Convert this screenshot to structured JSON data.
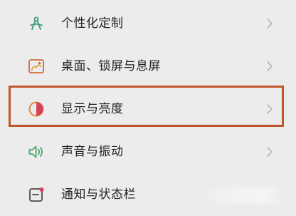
{
  "settings": {
    "items": [
      {
        "label": "个性化定制",
        "icon": "personalize-icon"
      },
      {
        "label": "桌面、锁屏与息屏",
        "icon": "wallpaper-icon"
      },
      {
        "label": "显示与亮度",
        "icon": "brightness-icon",
        "highlighted": true
      },
      {
        "label": "声音与振动",
        "icon": "speaker-icon"
      },
      {
        "label": "通知与状态栏",
        "icon": "notification-icon"
      }
    ]
  },
  "colors": {
    "background": "#ececec",
    "highlight_border": "#c0562c",
    "personalize_icon": "#3a9a7a",
    "wallpaper_icon": "#d2693c",
    "brightness_icon": "#e0863a",
    "speaker_icon": "#4aa86a",
    "notification_icon": "#d6425a"
  }
}
